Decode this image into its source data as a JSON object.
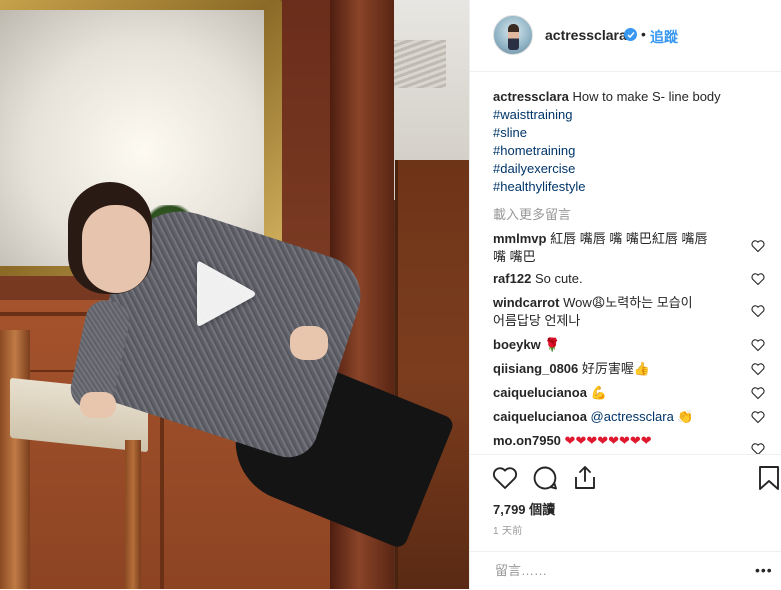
{
  "post": {
    "username": "actressclara",
    "follow_label": "追蹤",
    "separator": "•",
    "caption_text": "How to make S- line body",
    "hashtags": [
      "#waisttraining",
      "#sline",
      "#hometraining",
      "#dailyexercise",
      "#healthylifestyle"
    ],
    "load_more": "載入更多留言"
  },
  "comments": [
    {
      "user": "mmlmvp",
      "text": "紅唇 嘴唇 嘴 嘴巴紅唇 嘴唇",
      "text2": "嘴 嘴巴"
    },
    {
      "user": "raf122",
      "text": "So cute."
    },
    {
      "user": "windcarrot",
      "text": "Wow😩노력하는 모습이",
      "text2": "어름답당 언제나"
    },
    {
      "user": "boeykw",
      "text": "🌹"
    },
    {
      "user": "qiisiang_0806",
      "text": "好厉害喔👍"
    },
    {
      "user": "caiquelucianoa",
      "text": "💪"
    },
    {
      "user": "caiquelucianoa",
      "text": "@actressclara 👏"
    },
    {
      "user": "mo.on7950",
      "text": "❤❤❤❤❤❤❤❤"
    }
  ],
  "stats": {
    "views": "7,799 個讀",
    "time_ago": "1 天前"
  },
  "add_comment": {
    "placeholder": "留言……",
    "more": "•••"
  },
  "icons": {
    "heart": "heart-icon",
    "comment": "comment-icon",
    "share": "share-icon",
    "save": "bookmark-icon",
    "play": "play-icon",
    "verified": "verified-badge-icon"
  },
  "colors": {
    "link_blue": "#3897f0",
    "hashtag": "#003569",
    "muted": "#999999",
    "text": "#262626"
  }
}
